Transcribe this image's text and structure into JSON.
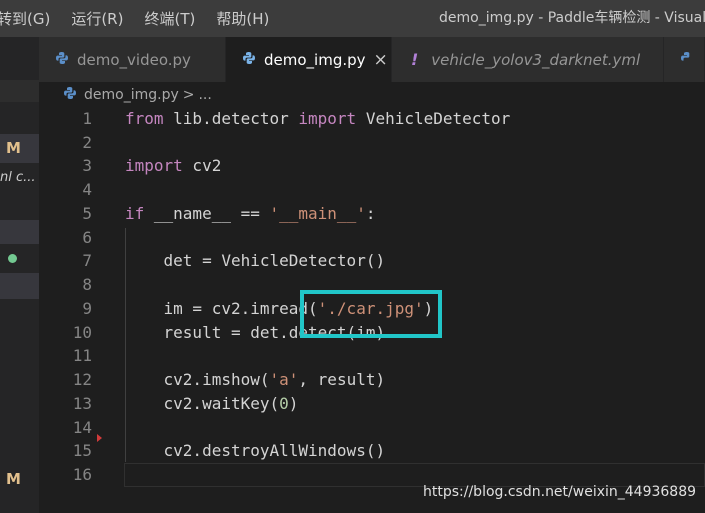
{
  "menu": {
    "items": [
      "转到(G)",
      "运行(R)",
      "终端(T)",
      "帮助(H)"
    ]
  },
  "window_title": "demo_img.py - Paddle车辆检测 - Visual",
  "sidebar": {
    "badge_top": "M",
    "partial_text": "nl c...",
    "badge_bottom": "M"
  },
  "tabs": [
    {
      "label": "demo_video.py",
      "icon": "python-icon"
    },
    {
      "label": "demo_img.py",
      "icon": "python-icon",
      "close": "×"
    },
    {
      "label": "vehicle_yolov3_darknet.yml",
      "icon": "!"
    }
  ],
  "breadcrumb": {
    "file": "demo_img.py",
    "separator": ">",
    "more": "..."
  },
  "code_lines": [
    {
      "n": "1"
    },
    {
      "n": "2"
    },
    {
      "n": "3"
    },
    {
      "n": "4"
    },
    {
      "n": "5"
    },
    {
      "n": "6"
    },
    {
      "n": "7"
    },
    {
      "n": "8"
    },
    {
      "n": "9"
    },
    {
      "n": "10"
    },
    {
      "n": "11"
    },
    {
      "n": "12"
    },
    {
      "n": "13"
    },
    {
      "n": "14"
    },
    {
      "n": "15"
    },
    {
      "n": "16"
    }
  ],
  "code": {
    "l1": {
      "kw1": "from",
      "mid": " lib.detector ",
      "kw2": "import",
      "rest": " VehicleDetector"
    },
    "l3": {
      "kw": "import",
      "rest": " cv2"
    },
    "l5": {
      "kw": "if",
      "dunder": " __name__ == ",
      "str": "'__main__'",
      "rest": ":"
    },
    "l7": "    det = VehicleDetector()",
    "l9": {
      "a": "    im = cv2.imread(",
      "str": "'./car.jpg'",
      "b": ")"
    },
    "l10": "    result = det.detect(im)",
    "l12": {
      "a": "    cv2.imshow(",
      "str": "'a'",
      "b": ", result)"
    },
    "l13": {
      "a": "    cv2.waitKey(",
      "num": "0",
      "b": ")"
    },
    "l15": "    cv2.destroyAllWindows()"
  },
  "watermark": "https://blog.csdn.net/weixin_44936889",
  "colors": {
    "highlight_box": "#21c6c8",
    "keyword": "#c586c0",
    "string": "#ce9178",
    "number": "#b5cea8"
  }
}
